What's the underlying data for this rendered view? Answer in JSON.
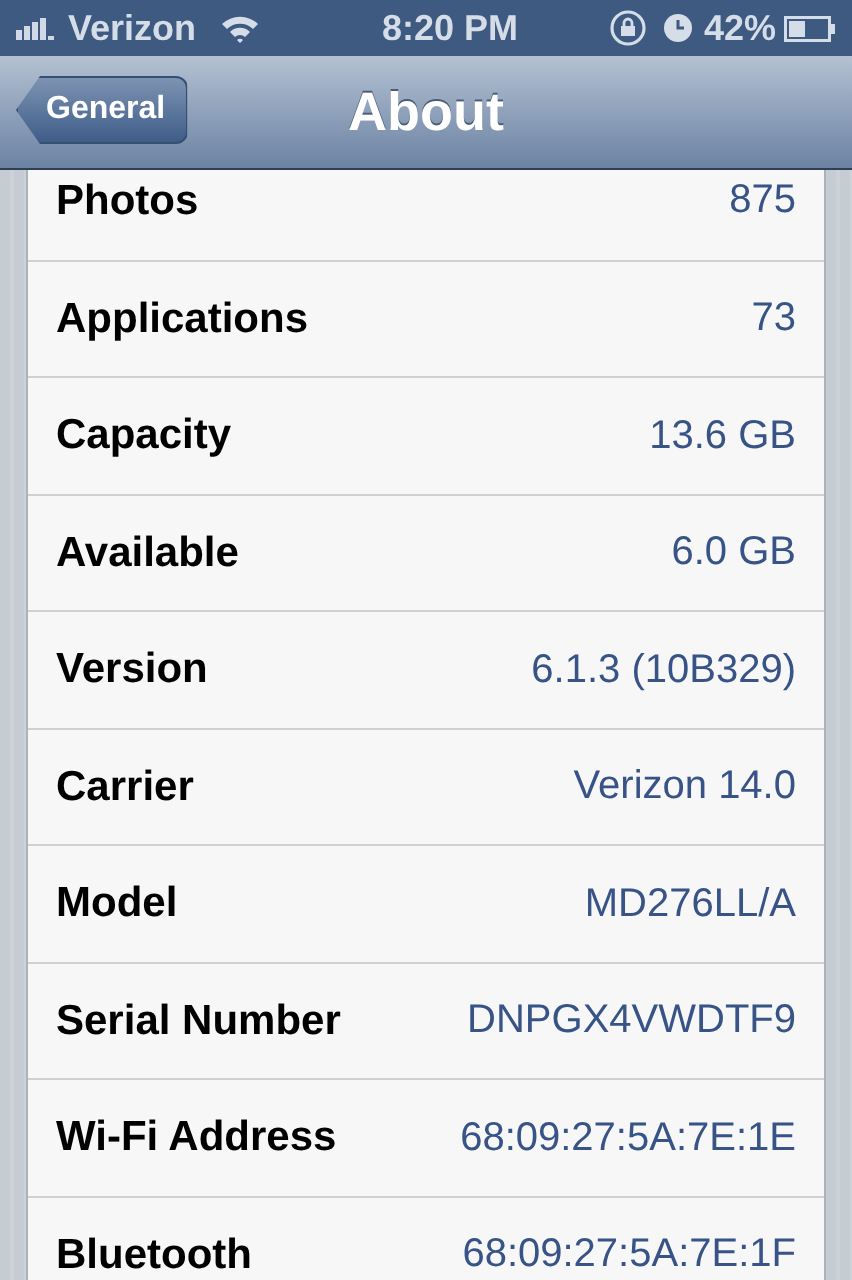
{
  "status_bar": {
    "carrier": "Verizon",
    "time": "8:20 PM",
    "battery": "42%"
  },
  "nav_bar": {
    "back": "General",
    "title": "About"
  },
  "rows": [
    {
      "label": "Photos",
      "value": "875"
    },
    {
      "label": "Applications",
      "value": "73"
    },
    {
      "label": "Capacity",
      "value": "13.6 GB"
    },
    {
      "label": "Available",
      "value": "6.0 GB"
    },
    {
      "label": "Version",
      "value": "6.1.3 (10B329)"
    },
    {
      "label": "Carrier",
      "value": "Verizon 14.0"
    },
    {
      "label": "Model",
      "value": "MD276LL/A"
    },
    {
      "label": "Serial Number",
      "value": "DNPGX4VWDTF9"
    },
    {
      "label": "Wi-Fi Address",
      "value": "68:09:27:5A:7E:1E"
    },
    {
      "label": "Bluetooth",
      "value": "68:09:27:5A:7E:1F"
    }
  ]
}
